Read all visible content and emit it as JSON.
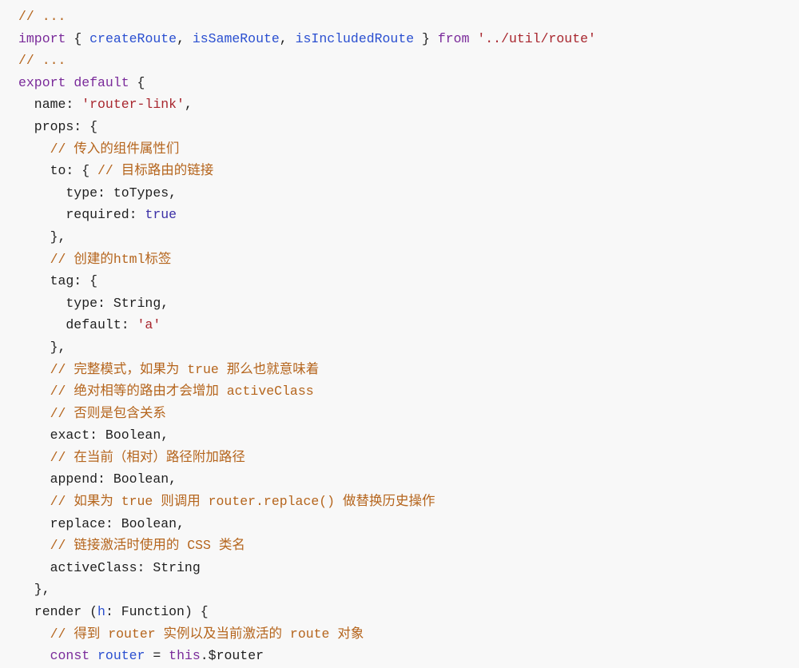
{
  "code_block": {
    "language": "javascript",
    "colors": {
      "background": "#f8f8f8",
      "comment": "#b5651d",
      "keyword": "#7a2a9a",
      "function": "#2a4fd0",
      "string": "#a8262e",
      "boolean": "#3b2fa6",
      "plain": "#1f1f1f"
    },
    "lines": [
      [
        {
          "t": "comment",
          "v": "// ..."
        }
      ],
      [
        {
          "t": "keyword",
          "v": "import"
        },
        {
          "t": "plain",
          "v": " { "
        },
        {
          "t": "func",
          "v": "createRoute"
        },
        {
          "t": "plain",
          "v": ", "
        },
        {
          "t": "func",
          "v": "isSameRoute"
        },
        {
          "t": "plain",
          "v": ", "
        },
        {
          "t": "func",
          "v": "isIncludedRoute"
        },
        {
          "t": "plain",
          "v": " } "
        },
        {
          "t": "keyword",
          "v": "from"
        },
        {
          "t": "plain",
          "v": " "
        },
        {
          "t": "string",
          "v": "'../util/route'"
        }
      ],
      [
        {
          "t": "comment",
          "v": "// ..."
        }
      ],
      [
        {
          "t": "keyword",
          "v": "export"
        },
        {
          "t": "plain",
          "v": " "
        },
        {
          "t": "keyword",
          "v": "default"
        },
        {
          "t": "plain",
          "v": " {"
        }
      ],
      [
        {
          "t": "plain",
          "v": "  name: "
        },
        {
          "t": "string",
          "v": "'router-link'"
        },
        {
          "t": "plain",
          "v": ","
        }
      ],
      [
        {
          "t": "plain",
          "v": "  props: {"
        }
      ],
      [
        {
          "t": "plain",
          "v": "    "
        },
        {
          "t": "comment",
          "v": "// 传入的组件属性们"
        }
      ],
      [
        {
          "t": "plain",
          "v": "    to: { "
        },
        {
          "t": "comment",
          "v": "// 目标路由的链接"
        }
      ],
      [
        {
          "t": "plain",
          "v": "      type: toTypes,"
        }
      ],
      [
        {
          "t": "plain",
          "v": "      required: "
        },
        {
          "t": "bool",
          "v": "true"
        }
      ],
      [
        {
          "t": "plain",
          "v": "    },"
        }
      ],
      [
        {
          "t": "plain",
          "v": "    "
        },
        {
          "t": "comment",
          "v": "// 创建的html标签"
        }
      ],
      [
        {
          "t": "plain",
          "v": "    tag: {"
        }
      ],
      [
        {
          "t": "plain",
          "v": "      type: String,"
        }
      ],
      [
        {
          "t": "plain",
          "v": "      default: "
        },
        {
          "t": "string",
          "v": "'a'"
        }
      ],
      [
        {
          "t": "plain",
          "v": "    },"
        }
      ],
      [
        {
          "t": "plain",
          "v": "    "
        },
        {
          "t": "comment",
          "v": "// 完整模式，如果为 true 那么也就意味着"
        }
      ],
      [
        {
          "t": "plain",
          "v": "    "
        },
        {
          "t": "comment",
          "v": "// 绝对相等的路由才会增加 activeClass"
        }
      ],
      [
        {
          "t": "plain",
          "v": "    "
        },
        {
          "t": "comment",
          "v": "// 否则是包含关系"
        }
      ],
      [
        {
          "t": "plain",
          "v": "    exact: Boolean,"
        }
      ],
      [
        {
          "t": "plain",
          "v": "    "
        },
        {
          "t": "comment",
          "v": "// 在当前（相对）路径附加路径"
        }
      ],
      [
        {
          "t": "plain",
          "v": "    append: Boolean,"
        }
      ],
      [
        {
          "t": "plain",
          "v": "    "
        },
        {
          "t": "comment",
          "v": "// 如果为 true 则调用 router.replace() 做替换历史操作"
        }
      ],
      [
        {
          "t": "plain",
          "v": "    replace: Boolean,"
        }
      ],
      [
        {
          "t": "plain",
          "v": "    "
        },
        {
          "t": "comment",
          "v": "// 链接激活时使用的 CSS 类名"
        }
      ],
      [
        {
          "t": "plain",
          "v": "    activeClass: String"
        }
      ],
      [
        {
          "t": "plain",
          "v": "  },"
        }
      ],
      [
        {
          "t": "plain",
          "v": "  render ("
        },
        {
          "t": "var",
          "v": "h"
        },
        {
          "t": "plain",
          "v": ": Function) {"
        }
      ],
      [
        {
          "t": "plain",
          "v": "    "
        },
        {
          "t": "comment",
          "v": "// 得到 router 实例以及当前激活的 route 对象"
        }
      ],
      [
        {
          "t": "plain",
          "v": "    "
        },
        {
          "t": "keyword",
          "v": "const"
        },
        {
          "t": "plain",
          "v": " "
        },
        {
          "t": "var",
          "v": "router"
        },
        {
          "t": "plain",
          "v": " = "
        },
        {
          "t": "keyword",
          "v": "this"
        },
        {
          "t": "plain",
          "v": ".$router"
        }
      ]
    ]
  }
}
